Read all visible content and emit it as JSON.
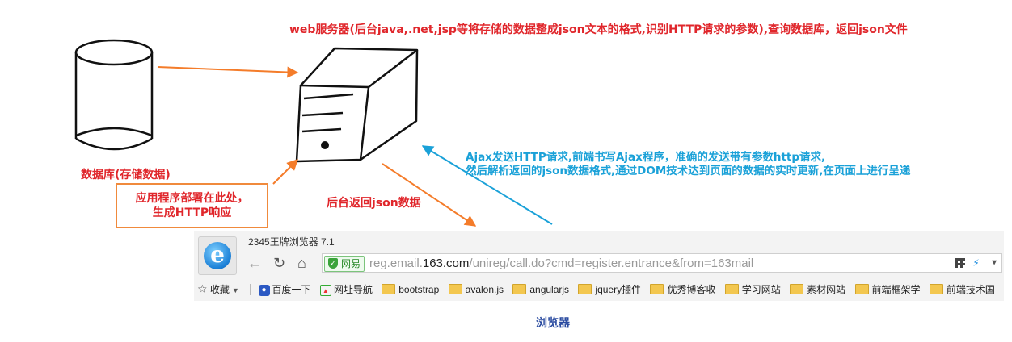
{
  "labels": {
    "server_desc": "web服务器(后台java,.net,jsp等将存储的数据整成json文本的格式,识别HTTP请求的参数),查询数据库，返回json文件",
    "database": "数据库(存储数据)",
    "deploy_line1": "应用程序部署在此处，",
    "deploy_line2": "生成HTTP响应",
    "backend_return": "后台返回json数据",
    "ajax_line1": "Ajax发送HTTP请求,前端书写Ajax程序，准确的发送带有参数http请求,",
    "ajax_line2": "然后解析返回的json数据格式,通过DOM技术达到页面的数据的实时更新,在页面上进行呈递",
    "browser_caption": "浏览器"
  },
  "colors": {
    "red": "#e0262b",
    "blue": "#1aa1d8",
    "orange": "#f47c2a",
    "caption_blue": "#2a4ba0"
  },
  "browser": {
    "title": "2345王牌浏览器 7.1",
    "logo_letter": "e",
    "secure_label": "网易",
    "url_prefix": "reg.email.",
    "url_domain": "163.com",
    "url_rest": "/unireg/call.do?cmd=register.entrance&from=163mail",
    "bookmarks": [
      {
        "label": "收藏",
        "icon": "star-icon"
      },
      {
        "label": "百度一下",
        "icon": "baidu-paw-icon"
      },
      {
        "label": "网址导航",
        "icon": "nav-site-icon"
      },
      {
        "label": "bootstrap",
        "icon": "folder-icon"
      },
      {
        "label": "avalon.js",
        "icon": "folder-icon"
      },
      {
        "label": "angularjs",
        "icon": "folder-icon"
      },
      {
        "label": "jquery插件",
        "icon": "folder-icon"
      },
      {
        "label": "优秀博客收",
        "icon": "folder-icon"
      },
      {
        "label": "学习网站",
        "icon": "folder-icon"
      },
      {
        "label": "素材网站",
        "icon": "folder-icon"
      },
      {
        "label": "前端框架学",
        "icon": "folder-icon"
      },
      {
        "label": "前端技术国",
        "icon": "folder-icon"
      }
    ]
  }
}
